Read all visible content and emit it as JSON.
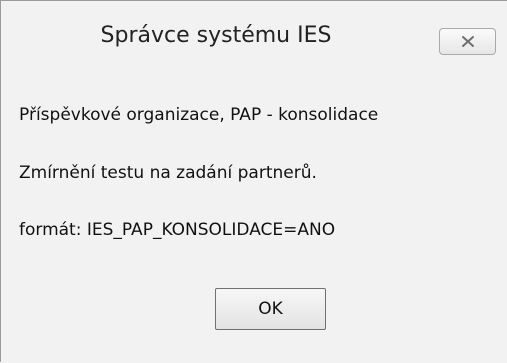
{
  "window": {
    "title": "Správce systému IES",
    "close_icon": "close-x-icon"
  },
  "message": {
    "line1": "Příspěvkové organizace, PAP - konsolidace",
    "line2": "Zmírnění testu na zadání partnerů.",
    "line3": "formát: IES_PAP_KONSOLIDACE=ANO"
  },
  "buttons": {
    "ok_label": "OK"
  },
  "colors": {
    "background": "#f2f2f2",
    "border": "#9a9a9a",
    "button_border": "#707070"
  }
}
